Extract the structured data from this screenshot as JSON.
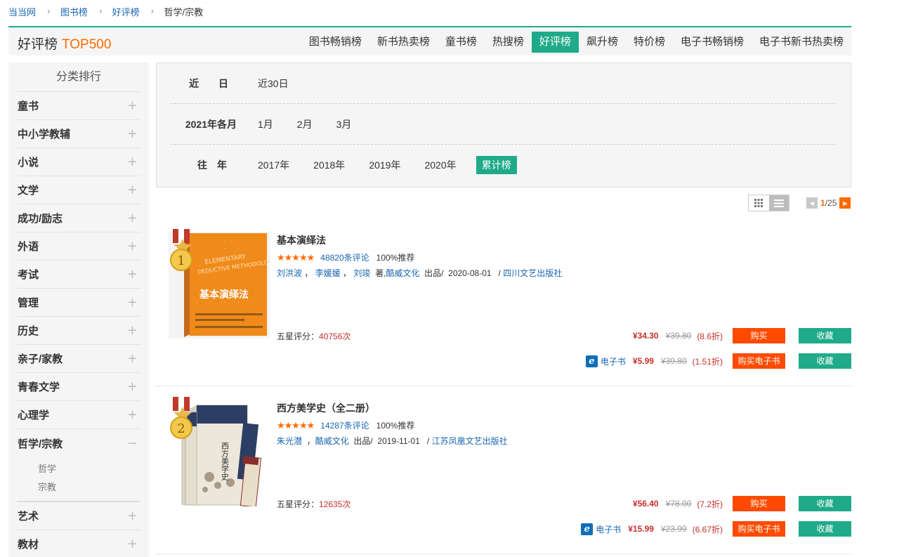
{
  "breadcrumb": {
    "items": [
      "当当网",
      "图书榜",
      "好评榜",
      "哲学/宗教"
    ]
  },
  "titlebar": {
    "title": "好评榜",
    "subtitle": "TOP500",
    "tabs": [
      {
        "label": "图书畅销榜",
        "active": false
      },
      {
        "label": "新书热卖榜",
        "active": false
      },
      {
        "label": "童书榜",
        "active": false
      },
      {
        "label": "热搜榜",
        "active": false
      },
      {
        "label": "好评榜",
        "active": true
      },
      {
        "label": "飙升榜",
        "active": false
      },
      {
        "label": "特价榜",
        "active": false
      },
      {
        "label": "电子书畅销榜",
        "active": false
      },
      {
        "label": "电子书新书热卖榜",
        "active": false
      }
    ]
  },
  "sidebar": {
    "title": "分类排行",
    "items": [
      {
        "label": "童书",
        "toggle": "+"
      },
      {
        "label": "中小学教辅",
        "toggle": "+"
      },
      {
        "label": "小说",
        "toggle": "+"
      },
      {
        "label": "文学",
        "toggle": "+"
      },
      {
        "label": "成功/励志",
        "toggle": "+"
      },
      {
        "label": "外语",
        "toggle": "+"
      },
      {
        "label": "考试",
        "toggle": "+"
      },
      {
        "label": "管理",
        "toggle": "+"
      },
      {
        "label": "历史",
        "toggle": "+"
      },
      {
        "label": "亲子/家教",
        "toggle": "+"
      },
      {
        "label": "青春文学",
        "toggle": "+"
      },
      {
        "label": "心理学",
        "toggle": "+"
      },
      {
        "label": "哲学/宗教",
        "toggle": "−"
      }
    ],
    "sub_items": [
      "哲学",
      "宗教"
    ],
    "after_items": [
      {
        "label": "艺术",
        "toggle": "+"
      },
      {
        "label": "教材",
        "toggle": "+"
      }
    ]
  },
  "filter": {
    "recent_label": "近 日",
    "recent_options": [
      "近30日"
    ],
    "month_label": "2021年各月",
    "month_options": [
      "1月",
      "2月",
      "3月"
    ],
    "year_label": "往年",
    "year_options": [
      "2017年",
      "2018年",
      "2019年",
      "2020年"
    ],
    "year_selected": "累计榜"
  },
  "pager": {
    "current": "1",
    "total": "/25"
  },
  "books": [
    {
      "rank": "1",
      "title": "基本演绎法",
      "stars": "★★★★★",
      "reviews": "48820条评论",
      "recommend": "100%推荐",
      "authors": [
        "刘洪波",
        "李媛媛",
        "刘竣"
      ],
      "author_suffix": "著",
      "publisher_brand": "酷威文化",
      "produced": "出品/",
      "date": "2020-08-01",
      "press": "四川文艺出版社",
      "fivestar_label": "五星评分：",
      "fivestar_count": "40756次",
      "price_now": "¥34.30",
      "price_old": "¥39.80",
      "discount": "(8.6折)",
      "buy": "购买",
      "fav": "收藏",
      "ebook_label": "电子书",
      "eprice_now": "¥5.99",
      "eprice_old": "¥39.80",
      "ediscount": "(1.51折)",
      "ebuy": "购买电子书",
      "efav": "收藏",
      "cover_color": "#f08a1a",
      "cover_title": "基本演绎法",
      "cover_en1": "ELEMENTARY",
      "cover_en2": "DEDUCTIVE METHODOLOGY"
    },
    {
      "rank": "2",
      "title": "西方美学史（全二册）",
      "stars": "★★★★★",
      "reviews": "14287条评论",
      "recommend": "100%推荐",
      "authors": [
        "朱光潜"
      ],
      "author_suffix": "",
      "publisher_brand": "酷威文化",
      "produced": "出品/",
      "date": "2019-11-01",
      "press": "江苏凤凰文艺出版社",
      "fivestar_label": "五星评分：",
      "fivestar_count": "12635次",
      "price_now": "¥56.40",
      "price_old": "¥78.00",
      "discount": "(7.2折)",
      "buy": "购买",
      "fav": "收藏",
      "ebook_label": "电子书",
      "eprice_now": "¥15.99",
      "eprice_old": "¥23.99",
      "ediscount": "(6.67折)",
      "ebuy": "购买电子书",
      "efav": "收藏",
      "cover_color": "#2c3e63",
      "cover_title": "西方美学史"
    }
  ]
}
